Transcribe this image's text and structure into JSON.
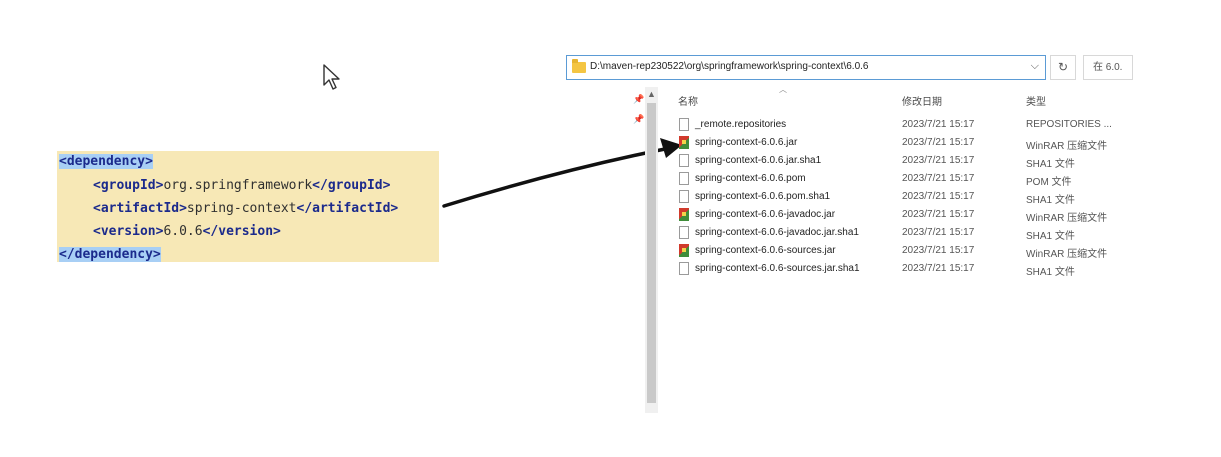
{
  "code": {
    "open_tag": "<dependency>",
    "group_open": "<groupId>",
    "group_value": "org.springframework",
    "group_close": "</groupId>",
    "artifact_open": "<artifactId>",
    "artifact_value": "spring-context",
    "artifact_close": "</artifactId>",
    "version_open": "<version>",
    "version_value": "6.0.6",
    "version_close": "</version>",
    "close_tag": "</dependency>"
  },
  "explorer": {
    "address_path": "D:\\maven-rep230522\\org\\springframework\\spring-context\\6.0.6",
    "dropdown_glyph": "⌵",
    "refresh_glyph": "↻",
    "search_placeholder": "在 6.0.",
    "columns": {
      "name": "名称",
      "date": "修改日期",
      "type": "类型"
    },
    "files": [
      {
        "name": "_remote.repositories",
        "date": "2023/7/21 15:17",
        "type": "REPOSITORIES ...",
        "icon": "file-icon"
      },
      {
        "name": "spring-context-6.0.6.jar",
        "date": "2023/7/21 15:17",
        "type": "WinRAR 压缩文件",
        "icon": "winrar-archive-icon"
      },
      {
        "name": "spring-context-6.0.6.jar.sha1",
        "date": "2023/7/21 15:17",
        "type": "SHA1 文件",
        "icon": "file-icon"
      },
      {
        "name": "spring-context-6.0.6.pom",
        "date": "2023/7/21 15:17",
        "type": "POM 文件",
        "icon": "file-icon"
      },
      {
        "name": "spring-context-6.0.6.pom.sha1",
        "date": "2023/7/21 15:17",
        "type": "SHA1 文件",
        "icon": "file-icon"
      },
      {
        "name": "spring-context-6.0.6-javadoc.jar",
        "date": "2023/7/21 15:17",
        "type": "WinRAR 压缩文件",
        "icon": "winrar-archive-icon"
      },
      {
        "name": "spring-context-6.0.6-javadoc.jar.sha1",
        "date": "2023/7/21 15:17",
        "type": "SHA1 文件",
        "icon": "file-icon"
      },
      {
        "name": "spring-context-6.0.6-sources.jar",
        "date": "2023/7/21 15:17",
        "type": "WinRAR 压缩文件",
        "icon": "winrar-archive-icon"
      },
      {
        "name": "spring-context-6.0.6-sources.jar.sha1",
        "date": "2023/7/21 15:17",
        "type": "SHA1 文件",
        "icon": "file-icon"
      }
    ]
  },
  "colors": {
    "code_bg": "#f7e8b6",
    "selection": "#a8cff5",
    "tag": "#1b2a8c",
    "address_border": "#5b9bd5"
  }
}
